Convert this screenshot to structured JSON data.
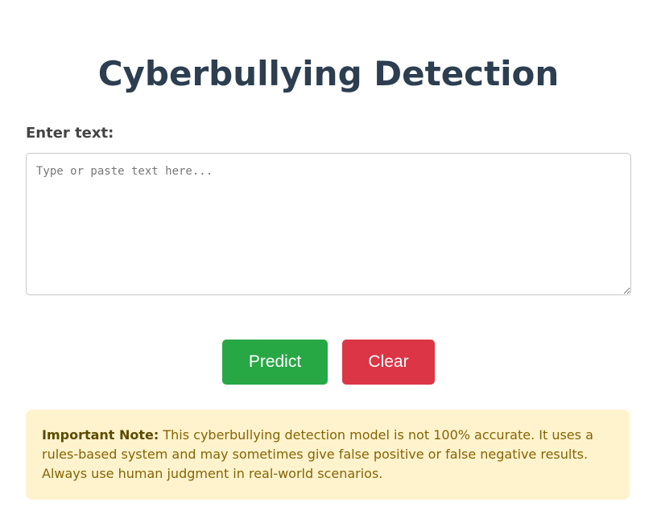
{
  "page": {
    "title": "Cyberbullying Detection"
  },
  "form": {
    "label": "Enter text:",
    "input_value": "",
    "placeholder": "Type or paste text here..."
  },
  "actions": {
    "predict_label": "Predict",
    "clear_label": "Clear"
  },
  "note": {
    "heading": "Important Note:",
    "body": " This cyberbullying detection model is not 100% accurate. It uses a rules-based system and may sometimes give false positive or false negative results. Always use human judgment in real-world scenarios."
  },
  "colors": {
    "title": "#2c3e50",
    "predict": "#28a745",
    "clear": "#dc3545",
    "note_bg": "#fff3cd",
    "note_text": "#856404"
  }
}
